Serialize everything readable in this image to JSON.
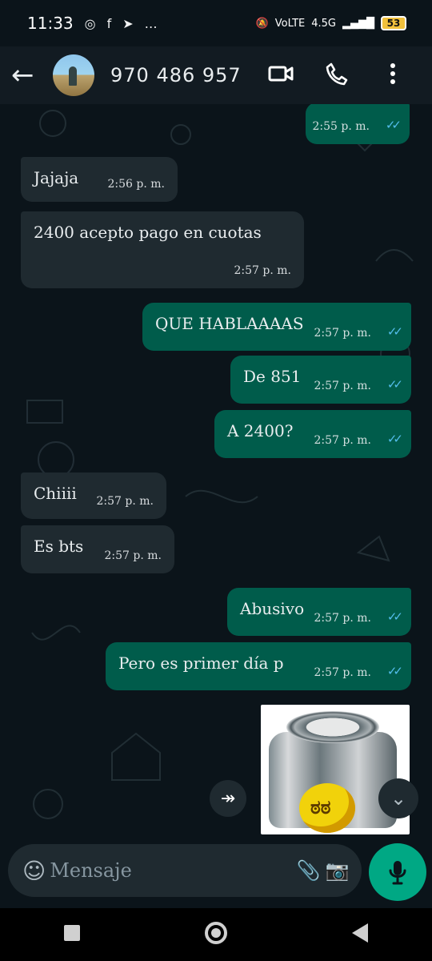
{
  "status_bar": {
    "time": "11:33",
    "network": "4.5G",
    "battery": "53"
  },
  "header": {
    "contact_name": "970 486 957"
  },
  "messages": [
    {
      "direction": "out",
      "text": "",
      "time": "2:55 p. m."
    },
    {
      "direction": "in",
      "text": "Jajaja",
      "time": "2:56 p. m."
    },
    {
      "direction": "in",
      "text": "2400 acepto pago en cuotas",
      "time": "2:57 p. m."
    },
    {
      "direction": "out",
      "text": "QUE HABLAAAAS",
      "time": "2:57 p. m."
    },
    {
      "direction": "out",
      "text": "De 851",
      "time": "2:57 p. m."
    },
    {
      "direction": "out",
      "text": "A 2400?",
      "time": "2:57 p. m."
    },
    {
      "direction": "in",
      "text": "Chiiii",
      "time": "2:57 p. m."
    },
    {
      "direction": "in",
      "text": "Es bts",
      "time": "2:57 p. m."
    },
    {
      "direction": "out",
      "text": "Abusivo",
      "time": "2:57 p. m."
    },
    {
      "direction": "out",
      "text": "Pero es primer día p",
      "time": "2:57 p. m."
    }
  ],
  "composer": {
    "placeholder": "Mensaje"
  },
  "icons": {
    "back": "arrow-left-icon",
    "video": "video-call-icon",
    "call": "phone-icon",
    "menu": "more-vertical-icon",
    "emoji": "emoji-icon",
    "attach": "paperclip-icon",
    "camera": "camera-icon",
    "mic": "microphone-icon"
  }
}
